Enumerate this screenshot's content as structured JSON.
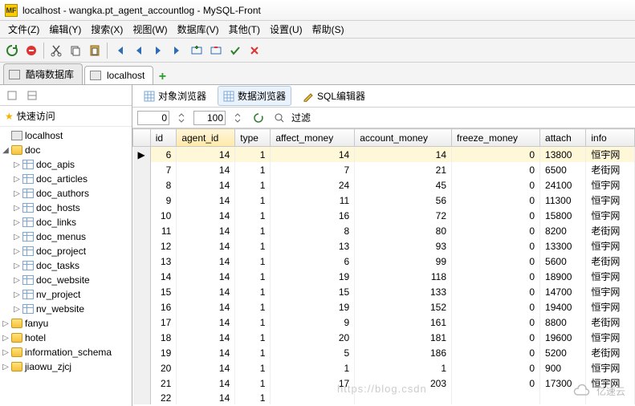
{
  "window": {
    "title": "localhost - wangka.pt_agent_accountlog - MySQL-Front"
  },
  "menu": [
    "文件(Z)",
    "编辑(Y)",
    "搜索(X)",
    "视图(W)",
    "数据库(V)",
    "其他(T)",
    "设置(U)",
    "帮助(S)"
  ],
  "top_tabs": {
    "items": [
      "酷嗨数据库",
      "localhost"
    ],
    "active_index": 1
  },
  "quick_access": "快速访问",
  "tree": {
    "host": "localhost",
    "dbs": [
      {
        "name": "doc",
        "expanded": true,
        "tables": [
          "doc_apis",
          "doc_articles",
          "doc_authors",
          "doc_hosts",
          "doc_links",
          "doc_menus",
          "doc_project",
          "doc_tasks",
          "doc_website",
          "nv_project",
          "nv_website"
        ]
      },
      {
        "name": "fanyu",
        "expanded": false
      },
      {
        "name": "hotel",
        "expanded": false
      },
      {
        "name": "information_schema",
        "expanded": false
      },
      {
        "name": "jiaowu_zjcj",
        "expanded": false
      }
    ]
  },
  "sub_tabs": {
    "items": [
      "对象浏览器",
      "数据浏览器",
      "SQL编辑器"
    ],
    "active_index": 1
  },
  "filter": {
    "from": "0",
    "to": "100",
    "label": "过滤"
  },
  "grid": {
    "columns": [
      "id",
      "agent_id",
      "type",
      "affect_money",
      "account_money",
      "freeze_money",
      "attach",
      "info"
    ],
    "sorted_col": "agent_id",
    "rows": [
      {
        "id": 6,
        "agent_id": 14,
        "type": 1,
        "affect_money": 14,
        "account_money": 14,
        "freeze_money": 0,
        "attach": "13800",
        "info": "恒宇网"
      },
      {
        "id": 7,
        "agent_id": 14,
        "type": 1,
        "affect_money": 7,
        "account_money": 21,
        "freeze_money": 0,
        "attach": "6500",
        "info": "老街网"
      },
      {
        "id": 8,
        "agent_id": 14,
        "type": 1,
        "affect_money": 24,
        "account_money": 45,
        "freeze_money": 0,
        "attach": "24100",
        "info": "恒宇网"
      },
      {
        "id": 9,
        "agent_id": 14,
        "type": 1,
        "affect_money": 11,
        "account_money": 56,
        "freeze_money": 0,
        "attach": "11300",
        "info": "恒宇网"
      },
      {
        "id": 10,
        "agent_id": 14,
        "type": 1,
        "affect_money": 16,
        "account_money": 72,
        "freeze_money": 0,
        "attach": "15800",
        "info": "恒宇网"
      },
      {
        "id": 11,
        "agent_id": 14,
        "type": 1,
        "affect_money": 8,
        "account_money": 80,
        "freeze_money": 0,
        "attach": "8200",
        "info": "老街网"
      },
      {
        "id": 12,
        "agent_id": 14,
        "type": 1,
        "affect_money": 13,
        "account_money": 93,
        "freeze_money": 0,
        "attach": "13300",
        "info": "恒宇网"
      },
      {
        "id": 13,
        "agent_id": 14,
        "type": 1,
        "affect_money": 6,
        "account_money": 99,
        "freeze_money": 0,
        "attach": "5600",
        "info": "老街网"
      },
      {
        "id": 14,
        "agent_id": 14,
        "type": 1,
        "affect_money": 19,
        "account_money": 118,
        "freeze_money": 0,
        "attach": "18900",
        "info": "恒宇网"
      },
      {
        "id": 15,
        "agent_id": 14,
        "type": 1,
        "affect_money": 15,
        "account_money": 133,
        "freeze_money": 0,
        "attach": "14700",
        "info": "恒宇网"
      },
      {
        "id": 16,
        "agent_id": 14,
        "type": 1,
        "affect_money": 19,
        "account_money": 152,
        "freeze_money": 0,
        "attach": "19400",
        "info": "恒宇网"
      },
      {
        "id": 17,
        "agent_id": 14,
        "type": 1,
        "affect_money": 9,
        "account_money": 161,
        "freeze_money": 0,
        "attach": "8800",
        "info": "老街网"
      },
      {
        "id": 18,
        "agent_id": 14,
        "type": 1,
        "affect_money": 20,
        "account_money": 181,
        "freeze_money": 0,
        "attach": "19600",
        "info": "恒宇网"
      },
      {
        "id": 19,
        "agent_id": 14,
        "type": 1,
        "affect_money": 5,
        "account_money": 186,
        "freeze_money": 0,
        "attach": "5200",
        "info": "老街网"
      },
      {
        "id": 20,
        "agent_id": 14,
        "type": 1,
        "affect_money": 1,
        "account_money": 1,
        "freeze_money": 0,
        "attach": "900",
        "info": "恒宇网"
      },
      {
        "id": 21,
        "agent_id": 14,
        "type": 1,
        "affect_money": 17,
        "account_money": 203,
        "freeze_money": 0,
        "attach": "17300",
        "info": "恒宇网"
      },
      {
        "id": 22,
        "agent_id": 14,
        "type": 1,
        "affect_money": "",
        "account_money": "",
        "freeze_money": "",
        "attach": "",
        "info": ""
      }
    ]
  },
  "watermark": {
    "brand": "亿速云",
    "url": "https://blog.csdn"
  }
}
